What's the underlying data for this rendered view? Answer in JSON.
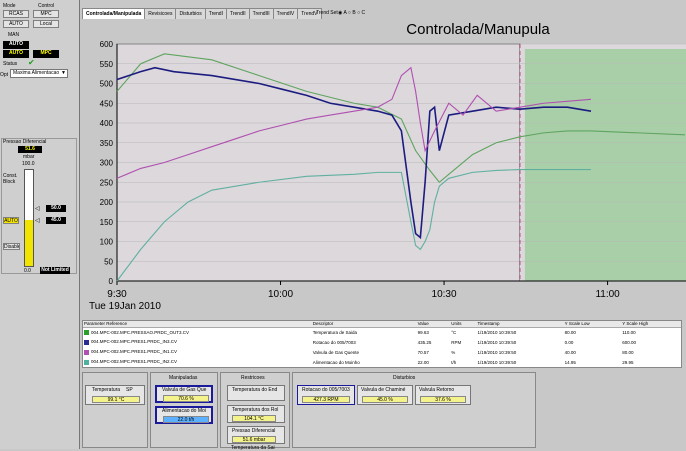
{
  "left_panel": {
    "mode_label": "Mode",
    "control_label": "Control",
    "mode_rcas": "RCAS",
    "mode_auto": "AUTO",
    "control_mpc": "MPC",
    "control_local": "Local",
    "man_label": "MAN",
    "auto_label": "AUTO",
    "auto_active": "AUTO",
    "mpc_active": "MPC",
    "status_label": "Status",
    "status_check": "✔",
    "opt_label": "Opt",
    "opt_value": "Maxima Alimentacao",
    "pressao_label": "Pressao Diferencial",
    "pressao_value": "51.6",
    "pressao_unit": "mbar",
    "scale_top": "100.0",
    "scale_bottom": "0.0",
    "const_block": "Const. Block",
    "auto_small": "AUTO",
    "sp_high": "50.0",
    "sp_low": "45.0",
    "disable_label": "Disable",
    "not_limited": "Not Limited"
  },
  "tabs": [
    "Controlada/Manipulada",
    "Revisicoes",
    "Disturbios",
    "TrendI",
    "TrendII",
    "TrendIII",
    "TrendIV",
    "TrendV"
  ],
  "trend_set": {
    "label": "Trend Set",
    "options": [
      "A",
      "B",
      "C"
    ]
  },
  "chart_data": {
    "type": "line",
    "title": "Controlada/Manupula",
    "ylim": [
      0,
      600
    ],
    "yticks": [
      0,
      50,
      100,
      150,
      200,
      250,
      300,
      350,
      400,
      450,
      500,
      550,
      600
    ],
    "xlim": [
      0,
      100
    ],
    "xticks": [
      {
        "x": 0,
        "label": "9:30"
      },
      {
        "x": 34.5,
        "label": "10:00"
      },
      {
        "x": 69,
        "label": "10:30"
      },
      {
        "x": 103.5,
        "label": "11:00"
      }
    ],
    "date_label": "Tue 19Jan 2010",
    "now_x": 85,
    "colors": {
      "plot_bg": "#dcd8dc",
      "future_bg": "#a9cfa9",
      "grid": "#b8b8b8"
    },
    "series": [
      {
        "color": "#5fa45f",
        "x": [
          0,
          5,
          10,
          20,
          30,
          40,
          50,
          55,
          60,
          63,
          66,
          68,
          70,
          75,
          80,
          85,
          90,
          95,
          100,
          110,
          120
        ],
        "y": [
          480,
          550,
          575,
          560,
          520,
          480,
          450,
          440,
          410,
          330,
          280,
          250,
          270,
          320,
          350,
          365,
          375,
          380,
          380,
          375,
          370
        ]
      },
      {
        "color": "#1c1c80",
        "x": [
          0,
          5,
          8,
          12,
          20,
          30,
          35,
          40,
          45,
          50,
          55,
          58,
          60,
          62,
          63,
          64,
          65,
          66,
          67,
          68,
          70,
          75,
          80,
          85,
          90,
          95,
          100
        ],
        "y": [
          510,
          530,
          540,
          530,
          520,
          500,
          485,
          470,
          450,
          440,
          430,
          420,
          380,
          200,
          120,
          110,
          250,
          430,
          440,
          330,
          420,
          430,
          440,
          435,
          440,
          440,
          430
        ]
      },
      {
        "color": "#b050b0",
        "x": [
          0,
          5,
          10,
          15,
          20,
          25,
          30,
          35,
          40,
          45,
          50,
          55,
          58,
          60,
          62,
          63,
          64,
          65,
          67,
          70,
          73,
          76,
          80,
          85,
          90,
          95,
          100
        ],
        "y": [
          260,
          285,
          300,
          320,
          340,
          360,
          380,
          395,
          410,
          420,
          430,
          440,
          460,
          520,
          540,
          480,
          400,
          330,
          380,
          450,
          420,
          470,
          430,
          440,
          450,
          455,
          460
        ]
      },
      {
        "color": "#60b0a0",
        "x": [
          0,
          5,
          10,
          15,
          20,
          30,
          40,
          50,
          55,
          60,
          62,
          63,
          64,
          65,
          66,
          67,
          68,
          70,
          75,
          80,
          85,
          90,
          100
        ],
        "y": [
          0,
          80,
          150,
          200,
          230,
          250,
          265,
          270,
          275,
          275,
          150,
          90,
          80,
          100,
          130,
          200,
          240,
          260,
          275,
          280,
          282,
          282,
          282
        ]
      }
    ]
  },
  "param_table": {
    "headers": [
      "Parameter Reference",
      "Descriptor",
      "Value",
      "Units",
      "Timestamp",
      "Y Scale Low",
      "Y Scale High"
    ],
    "rows": [
      {
        "color": "#2aa02a",
        "ref": "004.MPC-002.MPC.PRESSAO.PRDC_OUT3.CV",
        "desc": "Temperatura de Saida",
        "value": "99.63",
        "units": "°C",
        "ts": "1/19/2010 10:39:50",
        "low": "80.00",
        "high": "110.00"
      },
      {
        "color": "#2b2b90",
        "ref": "004.MPC-002.MPC.PRES1.PRDC_IN3.CV",
        "desc": "Rotacao do 005/7003",
        "value": "435.25",
        "units": "RPM",
        "ts": "1/19/2010 10:39:50",
        "low": "0.00",
        "high": "600.00"
      },
      {
        "color": "#b050b0",
        "ref": "004.MPC-002.MPC.PRES1.PRDC_IN1.CV",
        "desc": "Valvula de Gas Quente",
        "value": "70.57",
        "units": "%",
        "ts": "1/19/2010 10:39:50",
        "low": "40.00",
        "high": "80.00"
      },
      {
        "color": "#4fb0a0",
        "ref": "004.MPC-002.MPC.PRES1.PRDC_IN2.CV",
        "desc": "Alimentacao do Moinho",
        "value": "22.00",
        "units": "t/h",
        "ts": "1/19/2010 10:39:50",
        "low": "14.95",
        "high": "29.95"
      }
    ]
  },
  "bottom": {
    "controladas_card": {
      "label": "Temperatura",
      "sub": "SP",
      "value": "99.1 °C"
    },
    "manipuladas_title": "Manipuladas",
    "manip1": {
      "label": "Valvula de Gas Que",
      "value": "70.6 %"
    },
    "manip2": {
      "label": "Alimentacao do Moi",
      "value": "22.0 t/h"
    },
    "restricoes_title": "Restricoes",
    "res1": {
      "label": "Temperatura do End",
      "value": ""
    },
    "res2": {
      "label": "Temperatura dos Rol",
      "value": "104.1 °C"
    },
    "res3": {
      "label": "Pressao Diferencial",
      "value": "51.6 mbar"
    },
    "res4": {
      "label": "Temperatura da Sai",
      "value": ""
    },
    "disturbios_title": "Disturbios",
    "dist1": {
      "label": "Rotacao do 005/7003",
      "value": "427.3 RPM"
    },
    "dist2": {
      "label": "Valvula de Chaminé",
      "value": "45.0 %"
    },
    "dist3": {
      "label": "Valvula Retorno",
      "value": "37.6 %"
    }
  }
}
